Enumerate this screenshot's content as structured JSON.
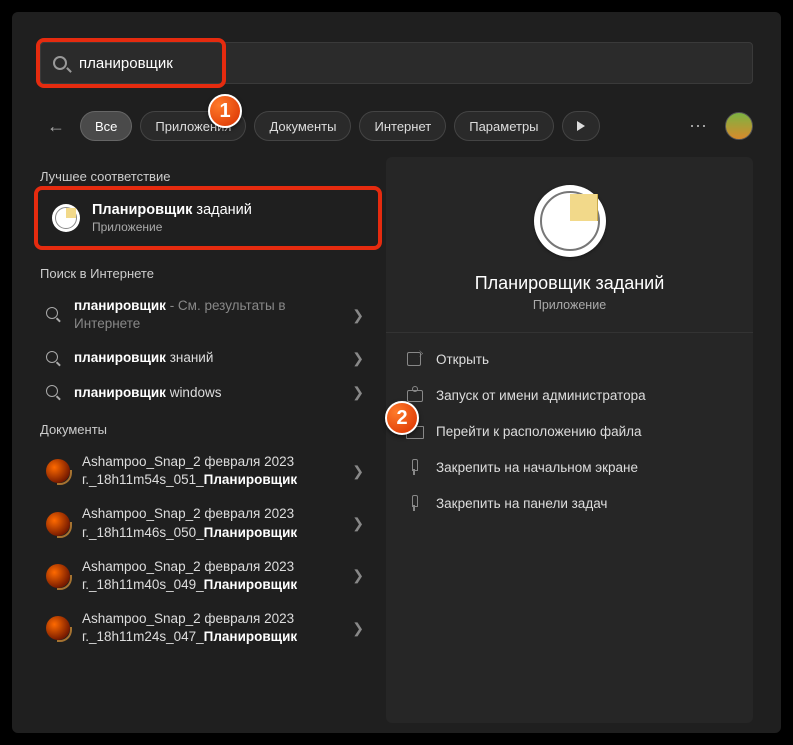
{
  "search": {
    "query": "планировщик"
  },
  "filters": {
    "all": "Все",
    "apps": "Приложения",
    "docs": "Документы",
    "internet": "Интернет",
    "params": "Параметры"
  },
  "badges": {
    "one": "1",
    "two": "2"
  },
  "sections": {
    "best": "Лучшее соответствие",
    "web": "Поиск в Интернете",
    "docs": "Документы"
  },
  "best_match": {
    "title_bold": "Планировщик",
    "title_rest": " заданий",
    "subtitle": "Приложение"
  },
  "web_results": [
    {
      "bold": "планировщик",
      "rest": " - См. результаты в Интернете"
    },
    {
      "bold": "планировщик",
      "rest": " знаний"
    },
    {
      "bold": "планировщик",
      "rest": " windows"
    }
  ],
  "doc_results": [
    {
      "line1": "Ashampoo_Snap_2 февраля 2023",
      "line2_pre": "г._18h11m54s_051_",
      "line2_bold": "Планировщик"
    },
    {
      "line1": "Ashampoo_Snap_2 февраля 2023",
      "line2_pre": "г._18h11m46s_050_",
      "line2_bold": "Планировщик"
    },
    {
      "line1": "Ashampoo_Snap_2 февраля 2023",
      "line2_pre": "г._18h11m40s_049_",
      "line2_bold": "Планировщик"
    },
    {
      "line1": "Ashampoo_Snap_2 февраля 2023",
      "line2_pre": "г._18h11m24s_047_",
      "line2_bold": "Планировщик"
    }
  ],
  "preview": {
    "title": "Планировщик заданий",
    "subtitle": "Приложение",
    "actions": {
      "open": "Открыть",
      "admin": "Запуск от имени администратора",
      "location": "Перейти к расположению файла",
      "pin_start": "Закрепить на начальном экране",
      "pin_taskbar": "Закрепить на панели задач"
    }
  }
}
